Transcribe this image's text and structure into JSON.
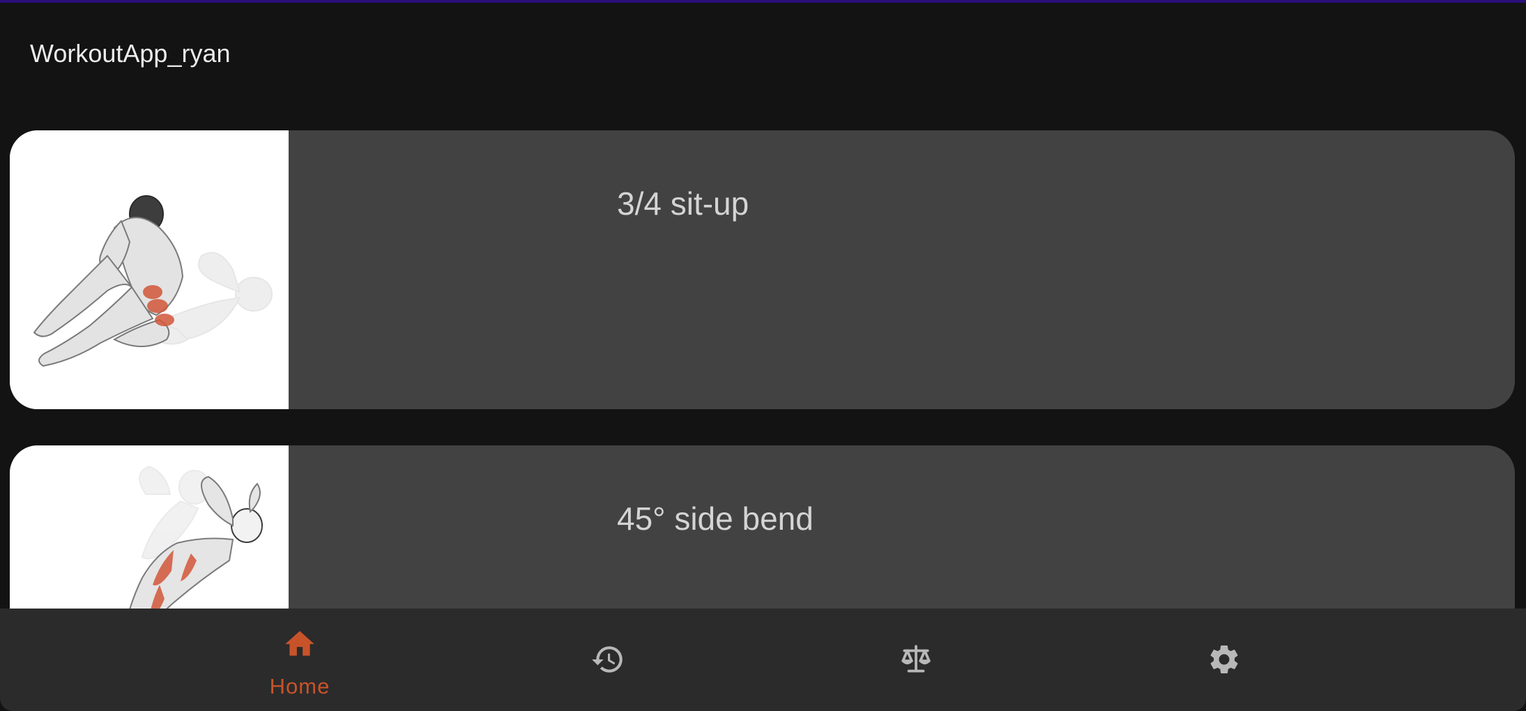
{
  "app": {
    "title": "WorkoutApp_ryan"
  },
  "exercises": [
    {
      "name": "3/4 sit-up",
      "image": "sit-up-illustration"
    },
    {
      "name": "45° side bend",
      "image": "side-bend-illustration"
    }
  ],
  "bottom_nav": {
    "items": [
      {
        "label": "Home",
        "icon": "home-icon",
        "active": true
      },
      {
        "label": "",
        "icon": "history-icon",
        "active": false
      },
      {
        "label": "",
        "icon": "scale-icon",
        "active": false
      },
      {
        "label": "",
        "icon": "gear-icon",
        "active": false
      }
    ]
  },
  "colors": {
    "background": "#131313",
    "card": "#424242",
    "nav_background": "#2b2b2b",
    "accent_active": "#c8532a",
    "icon_inactive": "#b8b8b8",
    "top_accent": "#2a0e7a"
  }
}
